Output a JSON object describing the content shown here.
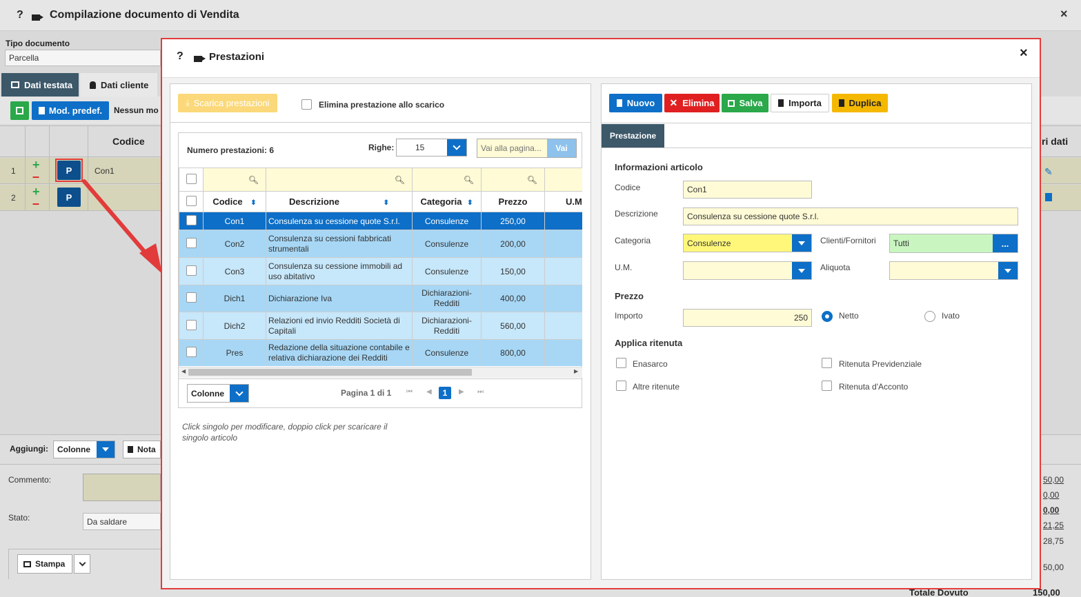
{
  "window": {
    "title": "Compilazione documento di Vendita"
  },
  "doc_type": {
    "label": "Tipo documento",
    "value": "Parcella"
  },
  "tabs": [
    {
      "label": "Dati testata"
    },
    {
      "label": "Dati cliente"
    }
  ],
  "toolbar": {
    "mod_predef": "Mod. predef.",
    "nessun": "Nessun mo"
  },
  "bg_grid": {
    "col_codice": "Codice",
    "col_right": "ri dati",
    "rows": [
      {
        "num": "1",
        "btn": "P",
        "code": "Con1"
      },
      {
        "num": "2",
        "btn": "P",
        "code": ""
      }
    ]
  },
  "bg_bottom": {
    "aggiungi": "Aggiungi:",
    "colonne": "Colonne",
    "nota": "Nota",
    "commento": "Commento:",
    "stato": "Stato:",
    "stato_value": "Da saldare",
    "stampa": "Stampa",
    "totale": "Totale Dovuto",
    "totale_val": "150,00",
    "amounts": [
      "50,00",
      "0,00",
      "0,00",
      "21,25",
      "28,75",
      "50,00"
    ]
  },
  "modal": {
    "title": "Prestazioni",
    "left": {
      "scarica_btn": "Scarica prestazioni",
      "elimina_label": "Elimina prestazione allo scarico",
      "count_label": "Numero prestazioni: 6",
      "righe_label": "Righe:",
      "righe_value": "15",
      "goto_placeholder": "Vai alla pagina...",
      "vai_btn": "Vai",
      "columns": {
        "codice": "Codice",
        "descrizione": "Descrizione",
        "categoria": "Categoria",
        "prezzo": "Prezzo",
        "um": "U.M"
      },
      "rows": [
        {
          "codice": "Con1",
          "descrizione": "Consulenza su cessione quote S.r.l.",
          "categoria": "Consulenze",
          "prezzo": "250,00"
        },
        {
          "codice": "Con2",
          "descrizione": "Consulenza su cessioni fabbricati strumentali",
          "categoria": "Consulenze",
          "prezzo": "200,00"
        },
        {
          "codice": "Con3",
          "descrizione": "Consulenza su cessione immobili ad uso abitativo",
          "categoria": "Consulenze",
          "prezzo": "150,00"
        },
        {
          "codice": "Dich1",
          "descrizione": "Dichiarazione Iva",
          "categoria": "Dichiarazioni-Redditi",
          "prezzo": "400,00"
        },
        {
          "codice": "Dich2",
          "descrizione": "Relazioni ed invio Redditi Società di Capitali",
          "categoria": "Dichiarazioni-Redditi",
          "prezzo": "560,00"
        },
        {
          "codice": "Pres",
          "descrizione": "Redazione della situazione contabile e relativa dichiarazione dei Redditi",
          "categoria": "Consulenze",
          "prezzo": "800,00"
        }
      ],
      "colonne_btn": "Colonne",
      "pagina": "Pagina 1 di 1",
      "page_num": "1",
      "hint": "Click singolo per modificare, doppio click per scaricare il singolo articolo"
    },
    "right": {
      "buttons": {
        "nuovo": "Nuovo",
        "elimina": "Elimina",
        "salva": "Salva",
        "importa": "Importa",
        "duplica": "Duplica"
      },
      "tab": "Prestazione",
      "info_title": "Informazioni articolo",
      "codice_label": "Codice",
      "codice_value": "Con1",
      "descrizione_label": "Descrizione",
      "descrizione_value": "Consulenza su cessione quote S.r.l.",
      "categoria_label": "Categoria",
      "categoria_value": "Consulenze",
      "clienti_label": "Clienti/Fornitori",
      "clienti_value": "Tutti",
      "clienti_btn": "...",
      "um_label": "U.M.",
      "um_value": "",
      "aliquota_label": "Aliquota",
      "aliquota_value": "",
      "prezzo_title": "Prezzo",
      "importo_label": "Importo",
      "importo_value": "250",
      "netto_label": "Netto",
      "ivato_label": "Ivato",
      "ritenuta_title": "Applica ritenuta",
      "enasarco": "Enasarco",
      "ritenuta_prev": "Ritenuta Previdenziale",
      "altre": "Altre ritenute",
      "acconto": "Ritenuta d'Acconto"
    }
  },
  "colors": {
    "accent": "#0d6fc7",
    "danger": "#e02020",
    "success": "#2aa84a",
    "warning": "#f5b800",
    "highlight": "#e23b3b"
  }
}
